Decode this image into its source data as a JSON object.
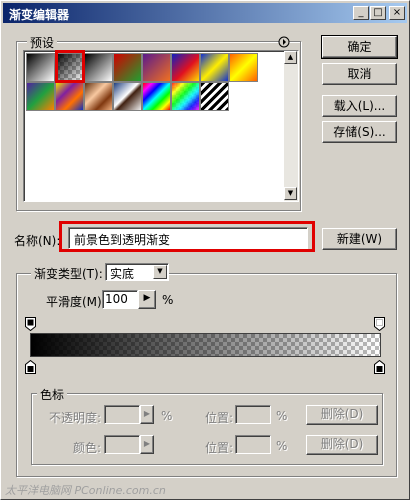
{
  "window": {
    "title": "渐变编辑器",
    "buttons": {
      "minimize": "_",
      "maximize": "□",
      "close": "×"
    }
  },
  "presets": {
    "label": "预设",
    "menu_icon": "circle-arrow-right-icon",
    "swatches": [
      {
        "name": "foreground-to-background",
        "css": "linear-gradient(135deg, #000 0%, #fff 100%)"
      },
      {
        "name": "foreground-to-transparent",
        "css": "linear-gradient(135deg, #000 0%, rgba(0,0,0,0) 100%)"
      },
      {
        "name": "black-white",
        "css": "linear-gradient(135deg, #000 0%, #fff 100%)"
      },
      {
        "name": "red-green",
        "css": "linear-gradient(135deg, #d00000 0%, #20a030 100%)"
      },
      {
        "name": "violet-orange",
        "css": "linear-gradient(135deg, #5a1a8c 0%, #f07020 100%)"
      },
      {
        "name": "blue-red-yellow",
        "css": "linear-gradient(135deg, #1020c0 0%, #e01020 55%, #ffe000 100%)"
      },
      {
        "name": "blue-yellow-blue",
        "css": "linear-gradient(135deg, #1030d0 0%, #ffee00 50%, #1030d0 100%)"
      },
      {
        "name": "orange-yellow-orange",
        "css": "linear-gradient(135deg, #ff6000 0%, #ffff00 50%, #ff6000 100%)"
      },
      {
        "name": "violet-green-orange",
        "css": "linear-gradient(135deg, #5020a0 0%, #20a040 50%, #ff8000 100%)"
      },
      {
        "name": "yellow-violet-orange-blue",
        "css": "linear-gradient(135deg, #f0e000 0%, #8020a0 35%, #ff7000 65%, #1030c0 100%)"
      },
      {
        "name": "copper",
        "css": "linear-gradient(135deg, #603010 0%, #f8c8a0 40%, #803810 70%, #f0b080 100%)"
      },
      {
        "name": "chrome",
        "css": "linear-gradient(135deg, #204080 0%, #ffffff 45%, #402010 55%, #f0f0f0 100%)"
      },
      {
        "name": "spectrum",
        "css": "linear-gradient(135deg, #ff0000, #ff00ff, #0000ff, #00ffff, #00ff00, #ffff00, #ff0000)"
      },
      {
        "name": "transparent-rainbow",
        "css": "linear-gradient(135deg, #ff0000, #ffff00, #00ff00, #00ffff, #0000ff, #ff00ff)"
      },
      {
        "name": "transparent-stripes",
        "css": "repeating-linear-gradient(135deg, #000 0px, #000 3px, #fff 3px, #fff 6px)"
      }
    ]
  },
  "name_field": {
    "label": "名称(N):",
    "value": "前景色到透明渐变"
  },
  "buttons": {
    "ok": "确定",
    "cancel": "取消",
    "load": "载入(L)...",
    "save": "存储(S)...",
    "new": "新建(W)"
  },
  "gradient_type": {
    "label": "渐变类型(T):",
    "value": "实底"
  },
  "smoothness": {
    "label": "平滑度(M):",
    "value": "100",
    "unit": "%"
  },
  "color_stops": {
    "label": "色标",
    "opacity_label": "不透明度:",
    "opacity_unit": "%",
    "location_label": "位置:",
    "location_unit": "%",
    "delete_label": "删除(D)",
    "color_label": "颜色:"
  },
  "watermark": "太平洋电脑网 PConline.com.cn",
  "colors": {
    "title_start": "#0a246a",
    "title_end": "#a6caf0",
    "highlight_red": "#e00000"
  }
}
